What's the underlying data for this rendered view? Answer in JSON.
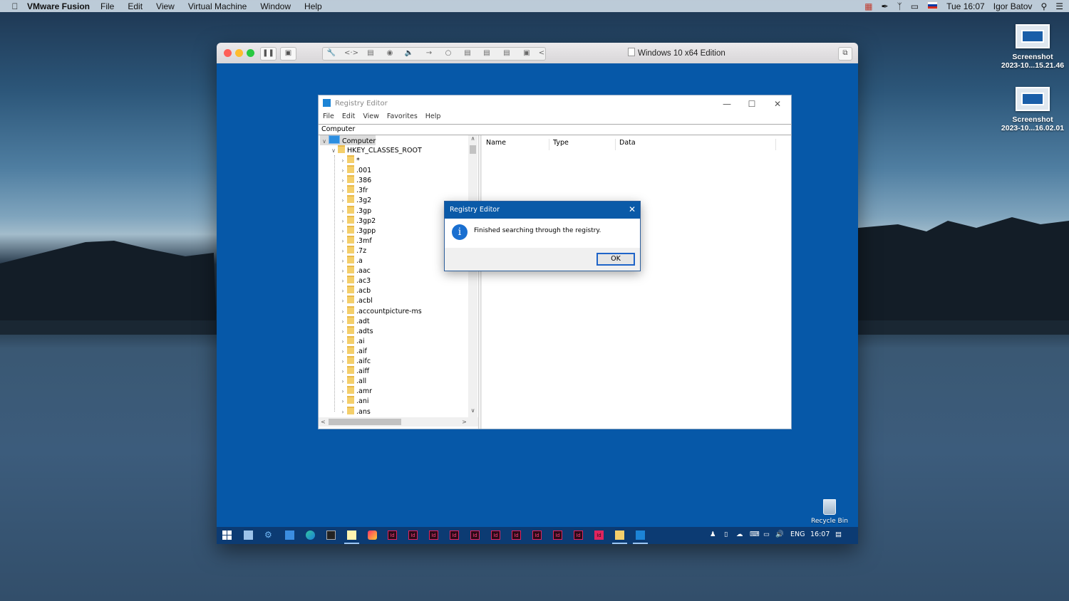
{
  "menubar": {
    "apple_icon": "apple-icon",
    "app_name": "VMware Fusion",
    "items": [
      "File",
      "Edit",
      "View",
      "Virtual Machine",
      "Window",
      "Help"
    ],
    "clock": "Tue 16:07",
    "user": "Igor Batov"
  },
  "desktop_icons": [
    {
      "line1": "Screenshot",
      "line2": "2023-10...15.21.46"
    },
    {
      "line1": "Screenshot",
      "line2": "2023-10...16.02.01"
    }
  ],
  "vmware": {
    "vm_name": "Windows 10 x64 Edition"
  },
  "regedit": {
    "title": "Registry Editor",
    "menu": [
      "File",
      "Edit",
      "View",
      "Favorites",
      "Help"
    ],
    "address": "Computer",
    "tree_root": "Computer",
    "hive": "HKEY_CLASSES_ROOT",
    "keys": [
      "*",
      ".001",
      ".386",
      ".3fr",
      ".3g2",
      ".3gp",
      ".3gp2",
      ".3gpp",
      ".3mf",
      ".7z",
      ".a",
      ".aac",
      ".ac3",
      ".acb",
      ".acbl",
      ".accountpicture-ms",
      ".adt",
      ".adts",
      ".ai",
      ".aif",
      ".aifc",
      ".aiff",
      ".all",
      ".amr",
      ".ani",
      ".ans"
    ],
    "columns": [
      "Name",
      "Type",
      "Data"
    ]
  },
  "dialog": {
    "title": "Registry Editor",
    "message": "Finished searching through the registry.",
    "ok_label": "OK"
  },
  "recycle_bin": "Recycle Bin",
  "taskbar": {
    "language": "ENG",
    "time": "16:07",
    "id_label": "Id"
  },
  "colors": {
    "win_desktop": "#0658a8",
    "taskbar": "#0c3b73",
    "dialog_title": "#0a5aa8"
  }
}
